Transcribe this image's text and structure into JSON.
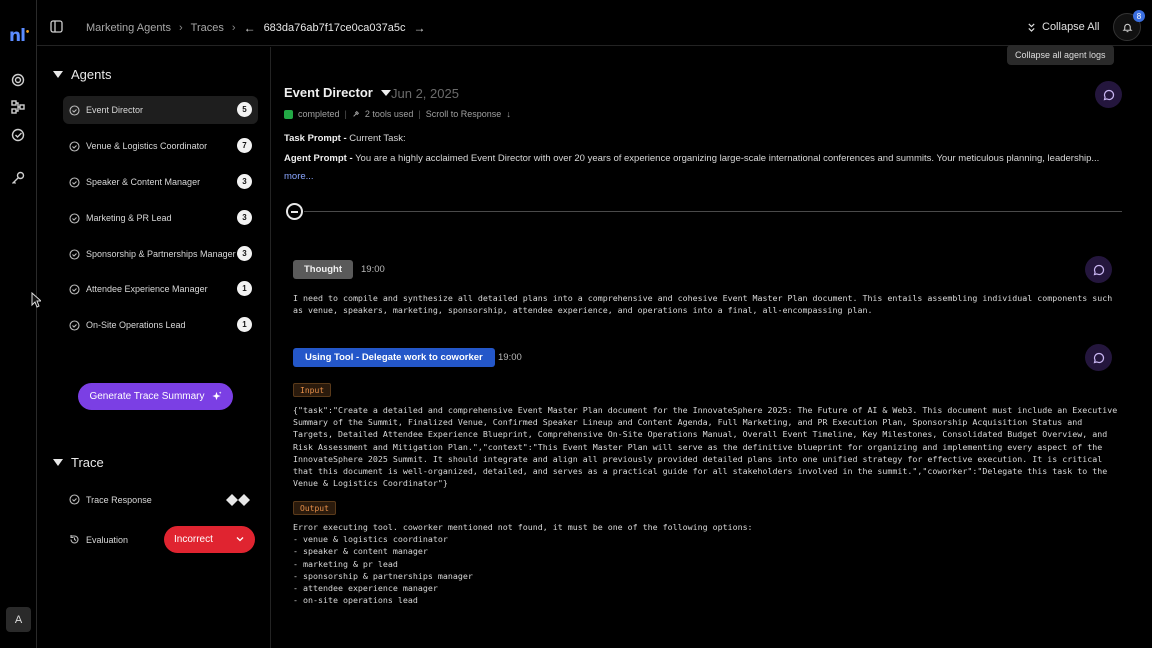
{
  "app": {
    "logo_text": "nl"
  },
  "header": {
    "breadcrumbs": [
      "Marketing Agents",
      "Traces"
    ],
    "trace_id": "683da76ab7f17ce0ca037a5c",
    "collapse_all_label": "Collapse All",
    "collapse_tooltip": "Collapse all agent logs",
    "notification_count": "8"
  },
  "sidebar": {
    "agents_heading": "Agents",
    "agents": [
      {
        "label": "Event Director",
        "count": "5"
      },
      {
        "label": "Venue & Logistics Coordinator",
        "count": "7"
      },
      {
        "label": "Speaker & Content Manager",
        "count": "3"
      },
      {
        "label": "Marketing & PR Lead",
        "count": "3"
      },
      {
        "label": "Sponsorship & Partnerships Manager",
        "count": "3"
      },
      {
        "label": "Attendee Experience Manager",
        "count": "1"
      },
      {
        "label": "On-Site Operations Lead",
        "count": "1"
      }
    ],
    "generate_button": "Generate Trace Summary",
    "trace_heading": "Trace",
    "trace_response_label": "Trace Response",
    "evaluation_label": "Evaluation",
    "evaluation_value": "Incorrect",
    "avatar_initial": "A"
  },
  "main": {
    "agent_name": "Event Director",
    "date": "Jun 2, 2025",
    "status": "completed",
    "tools_used": "2 tools used",
    "scroll_link": "Scroll to Response",
    "task_prompt_label": "Task Prompt -",
    "task_prompt_text": " Current Task:",
    "agent_prompt_label": "Agent Prompt -",
    "agent_prompt_text": " You are a highly acclaimed Event Director with over 20 years of experience organizing large-scale international conferences and summits. Your meticulous planning, leadership...",
    "more_link": "more...",
    "thought_tag": "Thought",
    "thought_time": "19:00",
    "thought_text": "I need to compile and synthesize all detailed plans into a comprehensive and cohesive Event Master Plan document. This entails assembling individual components such\nas venue, speakers, marketing, sponsorship, attendee experience, and operations into a final, all-encompassing plan.",
    "tool_tag": "Using Tool - Delegate work to coworker",
    "tool_time": "19:00",
    "input_tag": "Input",
    "input_text": "{\"task\":\"Create a detailed and comprehensive Event Master Plan document for the InnovateSphere 2025: The Future of AI & Web3. This document must include an Executive\nSummary of the Summit, Finalized Venue, Confirmed Speaker Lineup and Content Agenda, Full Marketing, and PR Execution Plan, Sponsorship Acquisition Status and\nTargets, Detailed Attendee Experience Blueprint, Comprehensive On-Site Operations Manual, Overall Event Timeline, Key Milestones, Consolidated Budget Overview, and\nRisk Assessment and Mitigation Plan.\",\"context\":\"This Event Master Plan will serve as the definitive blueprint for organizing and implementing every aspect of the\nInnovateSphere 2025 Summit. It should integrate and align all previously provided detailed plans into one unified strategy for effective execution. It is critical\nthat this document is well-organized, detailed, and serves as a practical guide for all stakeholders involved in the summit.\",\"coworker\":\"Delegate this task to the\nVenue & Logistics Coordinator\"}",
    "output_tag": "Output",
    "output_text": "Error executing tool. coworker mentioned not found, it must be one of the following options:\n- venue & logistics coordinator\n- speaker & content manager\n- marketing & pr lead\n- sponsorship & partnerships manager\n- attendee experience manager\n- on-site operations lead"
  },
  "colors": {
    "accent_purple": "#7b3fe4",
    "tool_blue": "#2457c9",
    "incorrect_red": "#e02430",
    "completed_green": "#22a845"
  }
}
